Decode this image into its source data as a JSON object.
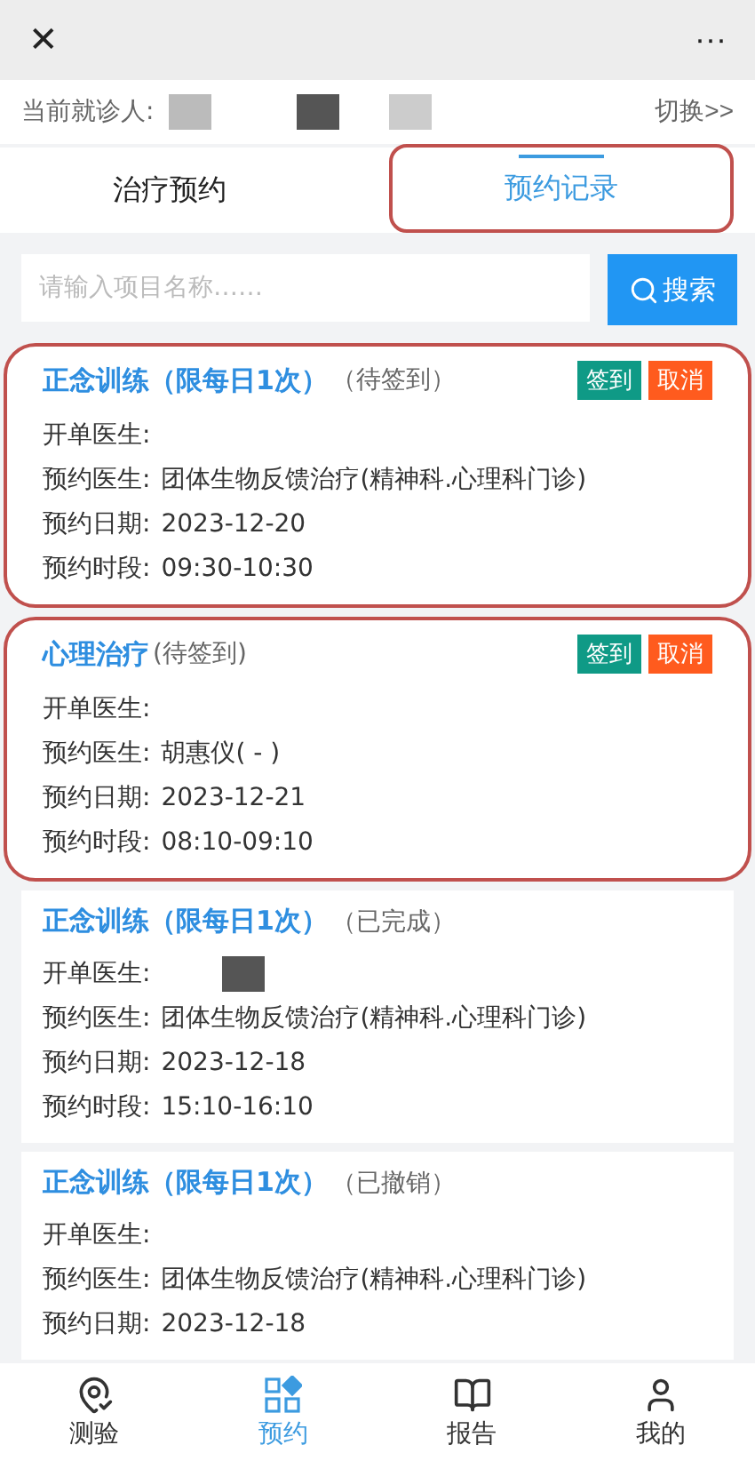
{
  "top_bar": {
    "close": "✕",
    "more": "···"
  },
  "patient_bar": {
    "label": "当前就诊人:",
    "redacted": true,
    "switch": "切换>>"
  },
  "tabs": [
    {
      "label": "治疗预约",
      "selected": false,
      "highlighted": false
    },
    {
      "label": "预约记录",
      "selected": true,
      "highlighted": true
    }
  ],
  "search": {
    "placeholder": "请输入项目名称……",
    "button": "搜索"
  },
  "records": [
    {
      "title": "正念训练（限每日1次）",
      "status": "（待签到）",
      "highlighted": true,
      "actions": [
        {
          "label": "签到",
          "kind": "checkin"
        },
        {
          "label": "取消",
          "kind": "cancel"
        }
      ],
      "fields": [
        {
          "label": "开单医生:"
        },
        {
          "label": "预约医生:",
          "value": "团体生物反馈治疗(精神科.心理科门诊)"
        },
        {
          "label": "预约日期:",
          "value": "2023-12-20"
        },
        {
          "label": "预约时段:",
          "value": "09:30-10:30"
        }
      ]
    },
    {
      "title": "心理治疗",
      "status": "(待签到)",
      "highlighted": true,
      "actions": [
        {
          "label": "签到",
          "kind": "checkin"
        },
        {
          "label": "取消",
          "kind": "cancel"
        }
      ],
      "fields": [
        {
          "label": "开单医生:"
        },
        {
          "label": "预约医生:",
          "value": "胡惠仪( - )"
        },
        {
          "label": "预约日期:",
          "value": "2023-12-21"
        },
        {
          "label": "预约时段:",
          "value": "08:10-09:10"
        }
      ]
    },
    {
      "title": "正念训练（限每日1次）",
      "status": "（已完成）",
      "highlighted": false,
      "fields": [
        {
          "label": "开单医生:",
          "redacted": true
        },
        {
          "label": "预约医生:",
          "value": "团体生物反馈治疗(精神科.心理科门诊)"
        },
        {
          "label": "预约日期:",
          "value": "2023-12-18"
        },
        {
          "label": "预约时段:",
          "value": "15:10-16:10"
        }
      ]
    },
    {
      "title": "正念训练（限每日1次）",
      "status": "（已撤销）",
      "highlighted": false,
      "fields": [
        {
          "label": "开单医生:"
        },
        {
          "label": "预约医生:",
          "value": "团体生物反馈治疗(精神科.心理科门诊)"
        },
        {
          "label": "预约日期:",
          "value": "2023-12-18"
        }
      ]
    }
  ],
  "bottom_nav": [
    {
      "label": "测验",
      "selected": false
    },
    {
      "label": "预约",
      "selected": true
    },
    {
      "label": "报告",
      "selected": false
    },
    {
      "label": "我的",
      "selected": false
    }
  ]
}
